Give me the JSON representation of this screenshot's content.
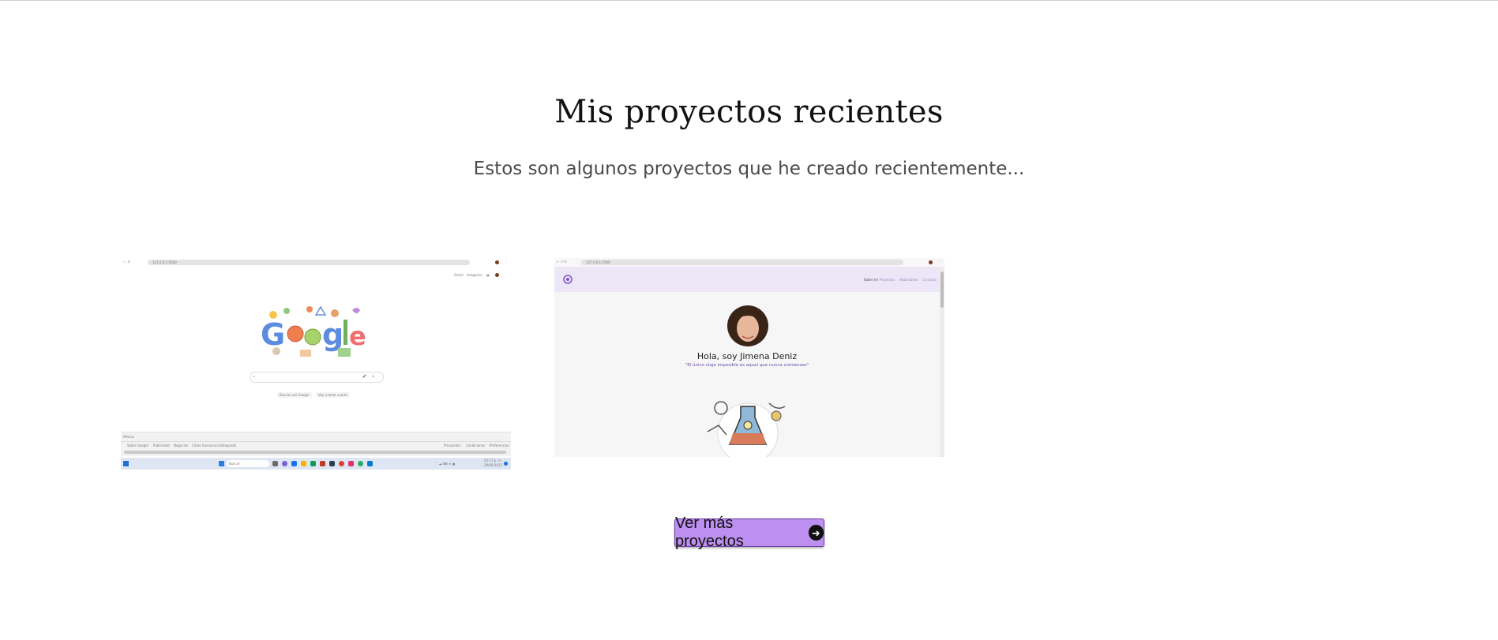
{
  "section": {
    "title": "Mis proyectos recientes",
    "subtitle": "Estos son algunos proyectos que he creado recientemente..."
  },
  "projects": [
    {
      "name": "google-clone-screenshot",
      "address": "127.0.0.1:5500",
      "top_links": [
        "Gmail",
        "Imágenes"
      ],
      "buttons": [
        "Buscar con Google",
        "Voy a tener suerte"
      ],
      "footer_region": "México",
      "footer_left": [
        "Sobre Google",
        "Publicidad",
        "Negocios",
        "Cómo funciona la Búsqueda"
      ],
      "footer_right": [
        "Privacidad",
        "Condiciones",
        "Preferencias"
      ],
      "taskbar_search": "Buscar",
      "clock_time": "03:11 p. m.",
      "clock_date": "29/09/2023"
    },
    {
      "name": "portfolio-screenshot",
      "address": "127.0.0.1:5500",
      "nav": [
        "Sobre mí",
        "Proyectos",
        "Habilidades",
        "Contacto"
      ],
      "heading": "Hola, soy Jimena Deniz",
      "quote": "\"El único viaje imposible es aquel que nunca comienzas\""
    }
  ],
  "cta": {
    "label": "Ver más proyectos",
    "icon": "arrow-right-icon"
  },
  "colors": {
    "accent": "#bd8ff0",
    "accent_border": "#6b3fa0",
    "portfolio_nav_bg": "#ece6f6"
  }
}
